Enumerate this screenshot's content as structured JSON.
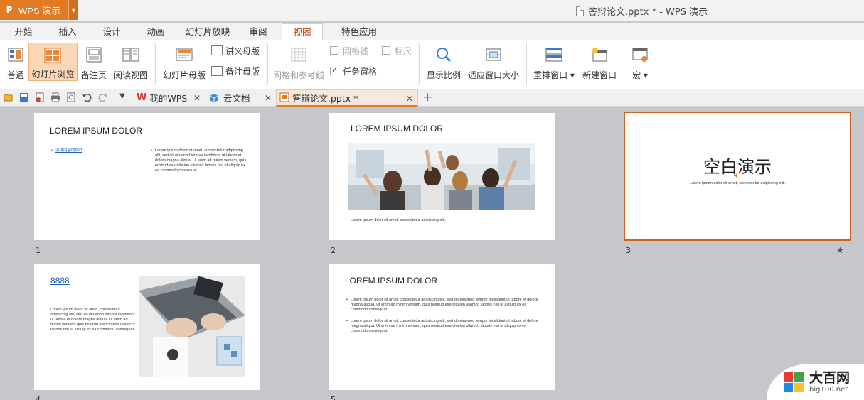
{
  "app": {
    "name": "WPS 演示",
    "logo": "P"
  },
  "window_title": "答辩论文.pptx * - WPS 演示",
  "menu_tabs": [
    "开始",
    "插入",
    "设计",
    "动画",
    "幻灯片放映",
    "审阅",
    "视图",
    "特色应用"
  ],
  "active_tab": "视图",
  "ribbon": {
    "normal": "普通",
    "slide_sorter": "幻灯片浏览",
    "notes_page": "备注页",
    "reading_view": "阅读视图",
    "slide_master": "幻灯片母版",
    "handout_master": "讲义母版",
    "notes_master": "备注母版",
    "grid_guides": "网格和参考线",
    "gridlines": "网格线",
    "ruler": "标尺",
    "task_pane": "任务窗格",
    "zoom": "显示比例",
    "fit_window": "适应窗口大小",
    "arrange_window": "重排窗口",
    "new_window": "新建窗口",
    "macro": "宏"
  },
  "doc_tabs": [
    {
      "label": "我的WPS"
    },
    {
      "label": "云文档"
    },
    {
      "label": "答辩论文.pptx *"
    }
  ],
  "slides": [
    {
      "number": "1",
      "title": "LOREM IPSUM DOLOR",
      "link": "演讲内容的PPT",
      "body": "Lorem ipsum dolor sit amet, consectetur adipiscing elit, sed do eiusmod tempor incididunt ut labore et dolore magna aliqua. Ut enim ad minim veniam, quis nostrud exercitation ullamco laboris nisi ut aliquip ex ea commodo consequat."
    },
    {
      "number": "2",
      "title": "LOREM IPSUM DOLOR",
      "caption": "Lorem ipsum dolor sit amet, consectetur adipiscing elit."
    },
    {
      "number": "3",
      "title": "空白演示",
      "caption": "Lorem ipsum dolor sit amet, consectetur adipiscing elit."
    },
    {
      "number": "4",
      "title": "8888",
      "body": "Lorem ipsum dolor sit amet, consectetur adipiscing elit, sed do eiusmod tempor incididunt ut labore et dolore magna aliqua. Ut enim ad minim veniam, quis nostrud exercitation ullamco laboris nisi ut aliquip ex ea commodo consequat."
    },
    {
      "number": "5",
      "title": "LOREM IPSUM DOLOR",
      "bullet1": "Lorem ipsum dolor sit amet, consectetur adipiscing elit, sed do eiusmod tempor incididunt ut labore et dolore magna aliqua. Ut enim ad minim veniam, quis nostrud exercitation ullamco laboris nisi ut aliquip ex ea commodo consequat.",
      "bullet2": "Lorem ipsum dolor sit amet, consectetur adipiscing elit, sed do eiusmod tempor incididunt ut labore et dolore magna aliqua. Ut enim ad minim veniam, quis nostrud exercitation ullamco laboris nisi ut aliquip ex ea commodo consequat."
    }
  ],
  "watermark": {
    "name": "大百网",
    "url": "big100.net"
  },
  "colors": {
    "accent": "#e07b24",
    "selected_border": "#c86420",
    "active_button": "#fbd7b6",
    "canvas": "#c6c7ca"
  }
}
